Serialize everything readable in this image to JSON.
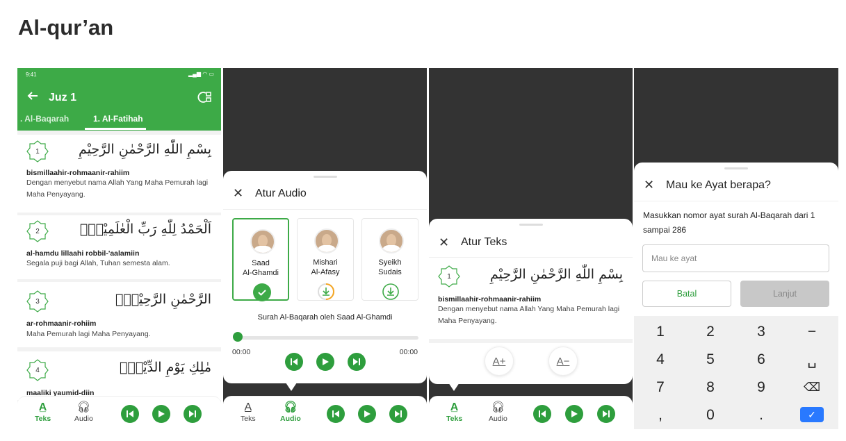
{
  "page": {
    "title": "Al-qur’an"
  },
  "colors": {
    "primary": "#3daa47",
    "accent_blue": "#2979ff",
    "dark_bg": "#333333"
  },
  "screen1": {
    "status": {
      "time": "9:41",
      "icons": "▂▄▆ ◠ ▭"
    },
    "appbar": {
      "back_icon": "arrow-left-icon",
      "title": "Juz 1",
      "settings_icon": "text-audio-settings-icon"
    },
    "tabs": [
      {
        "label": ". Al-Baqarah"
      },
      {
        "label": "1. Al-Fatihah"
      }
    ],
    "verses": [
      {
        "num": "1",
        "arabic": "بِسْمِ اللّٰهِ الرَّحْمٰنِ الرَّحِيْمِ",
        "latin": "bismillaahir-rohmaanir-rahiim",
        "translation": "Dengan menyebut nama Allah Yang Maha Pemurah lagi Maha Penyayang."
      },
      {
        "num": "2",
        "arabic": "اَلْحَمْدُ لِلّٰهِ رَبِّ الْعٰلَمِيْنَۙ",
        "latin": "al-hamdu lillaahi robbil-'aalamiin",
        "translation": "Segala puji bagi Allah, Tuhan semesta alam."
      },
      {
        "num": "3",
        "arabic": "الرَّحْمٰنِ الرَّحِيْمِۙ",
        "latin": "ar-rohmaanir-rohiim",
        "translation": "Maha Pemurah lagi Maha Penyayang."
      },
      {
        "num": "4",
        "arabic": "مٰلِكِ يَوْمِ الدِّيْنِۗ",
        "latin": "maaliki yaumid-diin",
        "translation": ""
      }
    ],
    "bottom": {
      "teks": "Teks",
      "audio": "Audio"
    }
  },
  "screen2": {
    "sheet": {
      "title": "Atur Audio",
      "close_icon": "close-icon"
    },
    "reciters": [
      {
        "name1": "Saad",
        "name2": "Al-Ghamdi",
        "status": "selected"
      },
      {
        "name1": "Mishari",
        "name2": "Al-Afasy",
        "status": "downloading"
      },
      {
        "name1": "Syeikh",
        "name2": "Sudais",
        "status": "download"
      }
    ],
    "now_playing": "Surah Al-Baqarah oleh Saad Al-Ghamdi",
    "progress": 0,
    "time_start": "00:00",
    "time_end": "00:00",
    "bottom": {
      "teks": "Teks",
      "audio": "Audio"
    }
  },
  "screen3": {
    "sheet": {
      "title": "Atur Teks",
      "close_icon": "close-icon"
    },
    "verse": {
      "num": "1",
      "arabic": "بِسْمِ اللّٰهِ الرَّحْمٰنِ الرَّحِيْمِ",
      "latin": "bismillaahir-rohmaanir-rahiim",
      "translation": "Dengan menyebut nama Allah Yang Maha Pemurah lagi Maha Penyayang."
    },
    "font_increase": "A+",
    "font_decrease": "A−",
    "bottom": {
      "teks": "Teks",
      "audio": "Audio"
    }
  },
  "screen4": {
    "sheet": {
      "title": "Mau ke Ayat berapa?",
      "close_icon": "close-icon"
    },
    "description": "Masukkan nomor ayat surah Al-Baqarah dari 1 sampai 286",
    "input_placeholder": "Mau ke ayat",
    "batal": "Batal",
    "lanjut": "Lanjut",
    "keys": [
      [
        "1",
        "2",
        "3",
        "−"
      ],
      [
        "4",
        "5",
        "6",
        "␣"
      ],
      [
        "7",
        "8",
        "9",
        "⌫"
      ],
      [
        ",",
        "0",
        ".",
        "✓"
      ]
    ]
  }
}
